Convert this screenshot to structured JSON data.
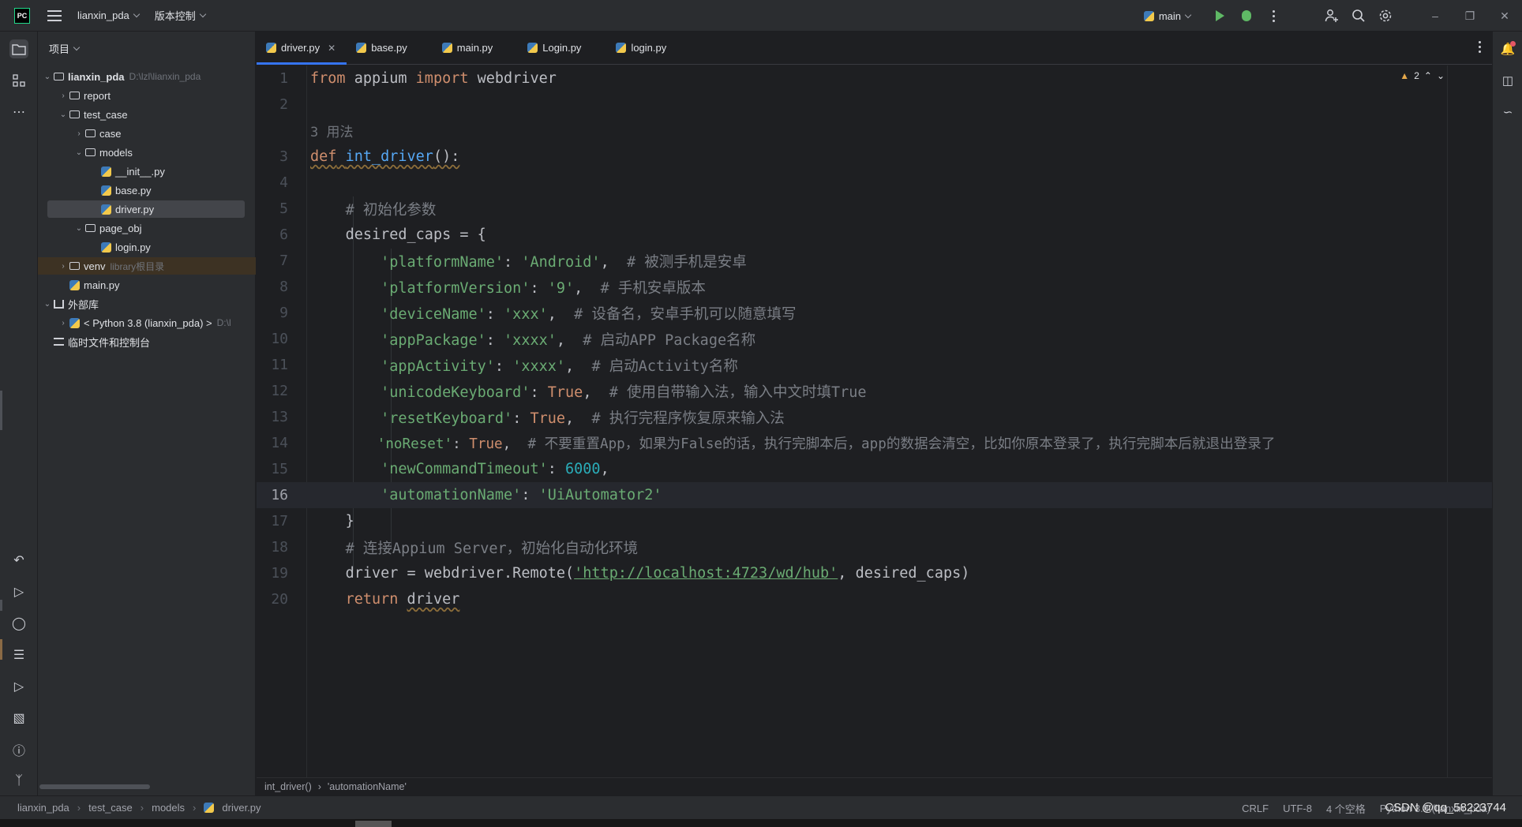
{
  "titlebar": {
    "logo": "PC",
    "project_name": "lianxin_pda",
    "vcs_menu": "版本控制",
    "run_config": "main"
  },
  "project_panel": {
    "header": "项目",
    "tree": [
      {
        "label": "lianxin_pda",
        "hint": "D:\\lzl\\lianxin_pda",
        "type": "folder",
        "expanded": true
      },
      {
        "label": "report",
        "type": "folder",
        "expanded": false
      },
      {
        "label": "test_case",
        "type": "folder",
        "expanded": true
      },
      {
        "label": "case",
        "type": "package",
        "expanded": false
      },
      {
        "label": "models",
        "type": "package",
        "expanded": true
      },
      {
        "label": "__init__.py",
        "type": "python-file"
      },
      {
        "label": "base.py",
        "type": "python-file"
      },
      {
        "label": "driver.py",
        "type": "python-file",
        "selected": true
      },
      {
        "label": "page_obj",
        "type": "package",
        "expanded": true
      },
      {
        "label": "login.py",
        "type": "python-file"
      },
      {
        "label": "venv",
        "hint": "library根目录",
        "type": "folder",
        "expanded": false
      },
      {
        "label": "main.py",
        "type": "python-file"
      },
      {
        "label": "外部库",
        "type": "library",
        "expanded": true
      },
      {
        "label": "< Python 3.8 (lianxin_pda) >",
        "hint": "D:\\l",
        "type": "python-sdk",
        "expanded": false
      },
      {
        "label": "临时文件和控制台",
        "type": "scratches"
      }
    ]
  },
  "tabs": [
    {
      "label": "driver.py",
      "active": true
    },
    {
      "label": "base.py"
    },
    {
      "label": "main.py"
    },
    {
      "label": "Login.py"
    },
    {
      "label": "login.py"
    }
  ],
  "editor": {
    "warning_count": "2",
    "current_line": "16",
    "usage_hint": "3 用法",
    "line_numbers": [
      "1",
      "2",
      "3",
      "4",
      "5",
      "6",
      "7",
      "8",
      "9",
      "10",
      "11",
      "12",
      "13",
      "14",
      "15",
      "16",
      "17",
      "18",
      "19",
      "20"
    ],
    "code": {
      "l1_from": "from",
      "l1_mod": " appium ",
      "l1_import": "import",
      "l1_name": " webdriver",
      "l3_def": "def",
      "l3_fn": "int_driver",
      "l3_rest": "():",
      "l5_comment": "# 初始化参数",
      "l6": "desired_caps = {",
      "l7_key": "'platformName'",
      "l7_val": "'Android'",
      "l7_comment": "# 被测手机是安卓",
      "l8_key": "'platformVersion'",
      "l8_val": "'9'",
      "l8_comment": "# 手机安卓版本",
      "l9_key": "'deviceName'",
      "l9_val": "'xxx'",
      "l9_comment": "# 设备名，安卓手机可以随意填写",
      "l10_key": "'appPackage'",
      "l10_val": "'xxxx'",
      "l10_comment": "# 启动APP Package名称",
      "l11_key": "'appActivity'",
      "l11_val": "'xxxx'",
      "l11_comment": "# 启动Activity名称",
      "l12_key": "'unicodeKeyboard'",
      "l12_val": "True",
      "l12_comment": "# 使用自带输入法，输入中文时填True",
      "l13_key": "'resetKeyboard'",
      "l13_val": "True",
      "l13_comment": "# 执行完程序恢复原来输入法",
      "l14_key": "'noReset'",
      "l14_val": "True",
      "l14_comment": "# 不要重置App，如果为False的话，执行完脚本后，app的数据会清空，比如你原本登录了，执行完脚本后就退出登录了",
      "l15_key": "'newCommandTimeout'",
      "l15_val": "6000",
      "l16_key": "'automationName'",
      "l16_val": "'UiAutomator2'",
      "l17": "}",
      "l18_comment": "# 连接Appium Server，初始化自动化环境",
      "l19_pre": "driver = webdriver.Remote(",
      "l19_url": "'http://localhost:4723/wd/hub'",
      "l19_post": ", desired_caps)",
      "l20_return": "return",
      "l20_name": "driver"
    }
  },
  "breadcrumb": {
    "function": "int_driver()",
    "key": "'automationName'"
  },
  "statusbar": {
    "path": [
      "lianxin_pda",
      "test_case",
      "models",
      "driver.py"
    ],
    "line_ending": "CRLF",
    "encoding": "UTF-8",
    "indent": "4 个空格",
    "interpreter": "Python 3.8 (lianxin_pda)"
  },
  "watermark": "CSDN @qq_58223744"
}
